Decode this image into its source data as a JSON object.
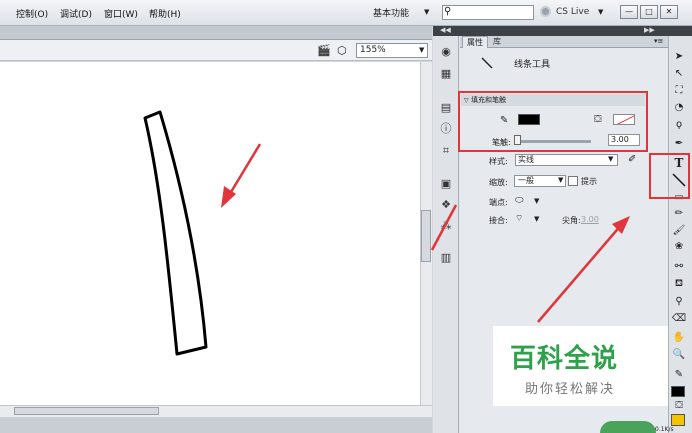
{
  "menubar": {
    "items": [
      "控制(O)",
      "调试(D)",
      "窗口(W)",
      "帮助(H)"
    ],
    "workspace": "基本功能",
    "cs_live": "CS Live",
    "win_min": "—",
    "win_max": "□",
    "win_close": "✕"
  },
  "stage": {
    "zoom": "155%"
  },
  "panel": {
    "tabs": [
      "属性",
      "库"
    ],
    "tool_name": "线条工具",
    "section_title": "填充和笔触",
    "stroke_label": "笔触:",
    "stroke_value": "3.00",
    "style_label": "样式:",
    "style_value": "实线",
    "scale_label": "缩放:",
    "scale_value": "一般",
    "hint_label": "提示",
    "cap_label": "端点:",
    "join_label": "接合:",
    "miter_label": "尖角:",
    "miter_value": "3.00"
  },
  "watermark": {
    "title": "百科全说",
    "subtitle": "助你轻松解决"
  },
  "status": {
    "text": "0.1K/s"
  },
  "colors": {
    "stroke": "#000000",
    "fill_tool": "#f5c400",
    "annotation": "#e0353a",
    "watermark": "#2ea24b"
  }
}
